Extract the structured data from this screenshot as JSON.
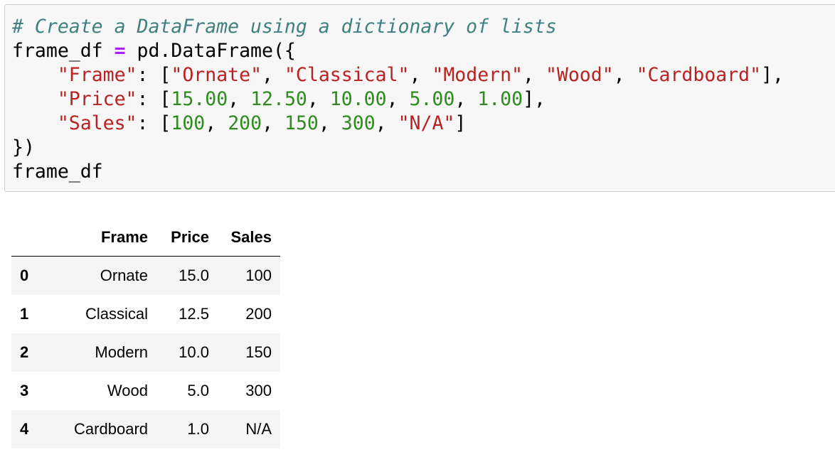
{
  "code_cell": {
    "comment": "# Create a DataFrame using a dictionary of lists",
    "line2_var": "frame_df ",
    "line2_op": "=",
    "line2_rest": " pd.DataFrame({",
    "frame_key": "\"Frame\"",
    "frame_sep": ": [",
    "frame_values": [
      "\"Ornate\"",
      "\"Classical\"",
      "\"Modern\"",
      "\"Wood\"",
      "\"Cardboard\""
    ],
    "frame_end": "],",
    "price_key": "\"Price\"",
    "price_sep": ": [",
    "price_values": [
      "15.00",
      "12.50",
      "10.00",
      "5.00",
      "1.00"
    ],
    "price_end": "],",
    "sales_key": "\"Sales\"",
    "sales_sep": ": [",
    "sales_values": [
      "100",
      "200",
      "150",
      "300"
    ],
    "sales_string_value": "\"N/A\"",
    "sales_end": "]",
    "close_line": "})",
    "last_line": "frame_df"
  },
  "output_table": {
    "columns": [
      "Frame",
      "Price",
      "Sales"
    ],
    "rows": [
      {
        "index": "0",
        "frame": "Ornate",
        "price": "15.0",
        "sales": "100"
      },
      {
        "index": "1",
        "frame": "Classical",
        "price": "12.5",
        "sales": "200"
      },
      {
        "index": "2",
        "frame": "Modern",
        "price": "10.0",
        "sales": "150"
      },
      {
        "index": "3",
        "frame": "Wood",
        "price": "5.0",
        "sales": "300"
      },
      {
        "index": "4",
        "frame": "Cardboard",
        "price": "1.0",
        "sales": "N/A"
      }
    ]
  },
  "colors": {
    "comment": "#408080",
    "operator": "#aa22ff",
    "string": "#ba2121",
    "number": "#2e8b1e",
    "cell_background": "#f7f7f7"
  }
}
